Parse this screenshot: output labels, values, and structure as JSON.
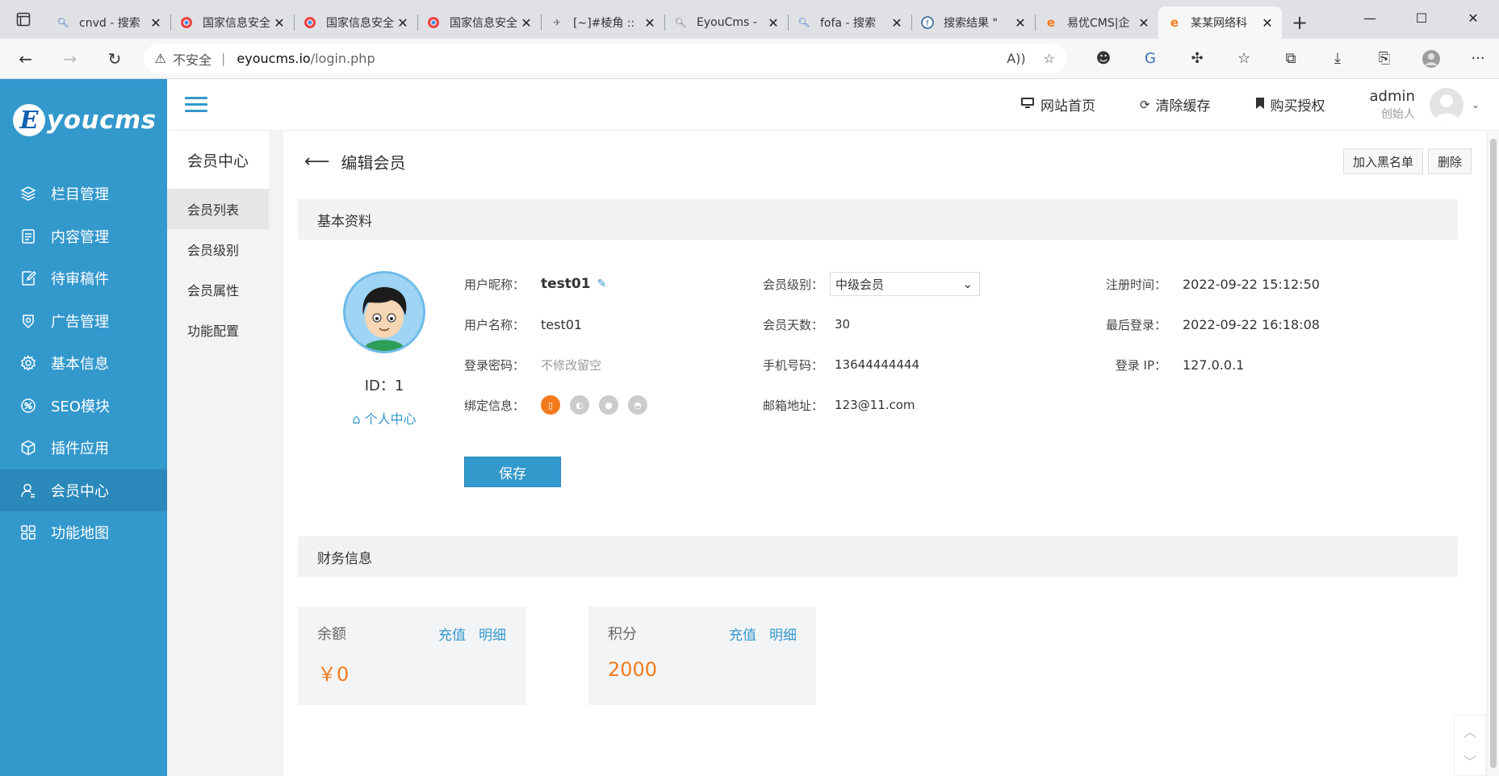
{
  "browser": {
    "tabs": [
      {
        "title": "cnvd - 搜索",
        "favicon": "search-icon",
        "active": false
      },
      {
        "title": "国家信息安全",
        "favicon": "chrome-icon",
        "active": false
      },
      {
        "title": "国家信息安全",
        "favicon": "chrome-icon",
        "active": false
      },
      {
        "title": "国家信息安全",
        "favicon": "chrome-icon",
        "active": false
      },
      {
        "title": "[~]#棱角 ::",
        "favicon": "plane-icon",
        "active": false
      },
      {
        "title": "EyouCms -",
        "favicon": "search-icon",
        "active": false
      },
      {
        "title": "fofa - 搜索",
        "favicon": "search-icon",
        "active": false
      },
      {
        "title": "搜索结果 \"",
        "favicon": "fofa-icon",
        "active": false
      },
      {
        "title": "易优CMS|企",
        "favicon": "eyou-icon",
        "active": false
      },
      {
        "title": "某某网络科",
        "favicon": "eyou-icon",
        "active": true
      }
    ],
    "insecure_label": "不安全",
    "url_host": "eyoucms.io",
    "url_path": "/login.php"
  },
  "sidebar": {
    "logo_letter": "E",
    "logo_text": "youcms",
    "items": [
      {
        "label": "栏目管理",
        "icon": "layers-icon"
      },
      {
        "label": "内容管理",
        "icon": "document-icon"
      },
      {
        "label": "待审稿件",
        "icon": "edit-document-icon"
      },
      {
        "label": "广告管理",
        "icon": "ad-icon"
      },
      {
        "label": "基本信息",
        "icon": "gear-icon"
      },
      {
        "label": "SEO模块",
        "icon": "seo-icon"
      },
      {
        "label": "插件应用",
        "icon": "cube-icon"
      },
      {
        "label": "会员中心",
        "icon": "user-icon",
        "active": true
      },
      {
        "label": "功能地图",
        "icon": "grid-icon"
      }
    ]
  },
  "topbar": {
    "links": [
      {
        "label": "网站首页",
        "icon": "monitor-icon"
      },
      {
        "label": "清除缓存",
        "icon": "refresh-icon"
      },
      {
        "label": "购买授权",
        "icon": "bookmark-icon"
      }
    ],
    "admin_name": "admin",
    "admin_role": "创始人"
  },
  "subnav": {
    "title": "会员中心",
    "items": [
      {
        "label": "会员列表",
        "active": true
      },
      {
        "label": "会员级别"
      },
      {
        "label": "会员属性"
      },
      {
        "label": "功能配置"
      }
    ]
  },
  "page": {
    "title": "编辑会员",
    "blacklist_button": "加入黑名单",
    "delete_button": "删除",
    "basic_section": "基本资料",
    "finance_section": "财务信息",
    "member_id": "ID：1",
    "personal_center": "个人中心",
    "save_button": "保存"
  },
  "fields": {
    "nickname_label": "用户昵称：",
    "nickname": "test01",
    "username_label": "用户名称：",
    "username": "test01",
    "password_label": "登录密码：",
    "password_placeholder": "不修改留空",
    "bind_label": "绑定信息：",
    "level_label": "会员级别：",
    "level_value": "中级会员",
    "days_label": "会员天数：",
    "days": "30",
    "phone_label": "手机号码：",
    "phone": "13644444444",
    "email_label": "邮箱地址：",
    "email": "123@11.com",
    "register_label": "注册时间：",
    "register_time": "2022-09-22 15:12:50",
    "last_login_label": "最后登录：",
    "last_login": "2022-09-22 16:18:08",
    "ip_label": "登录 IP：",
    "ip": "127.0.0.1"
  },
  "finance": {
    "balance_label": "余额",
    "balance_value": "￥0",
    "points_label": "积分",
    "points_value": "2000",
    "recharge_label": "充值",
    "detail_label": "明细"
  },
  "colors": {
    "accent": "#3398cc",
    "orange": "#f37b1d"
  }
}
